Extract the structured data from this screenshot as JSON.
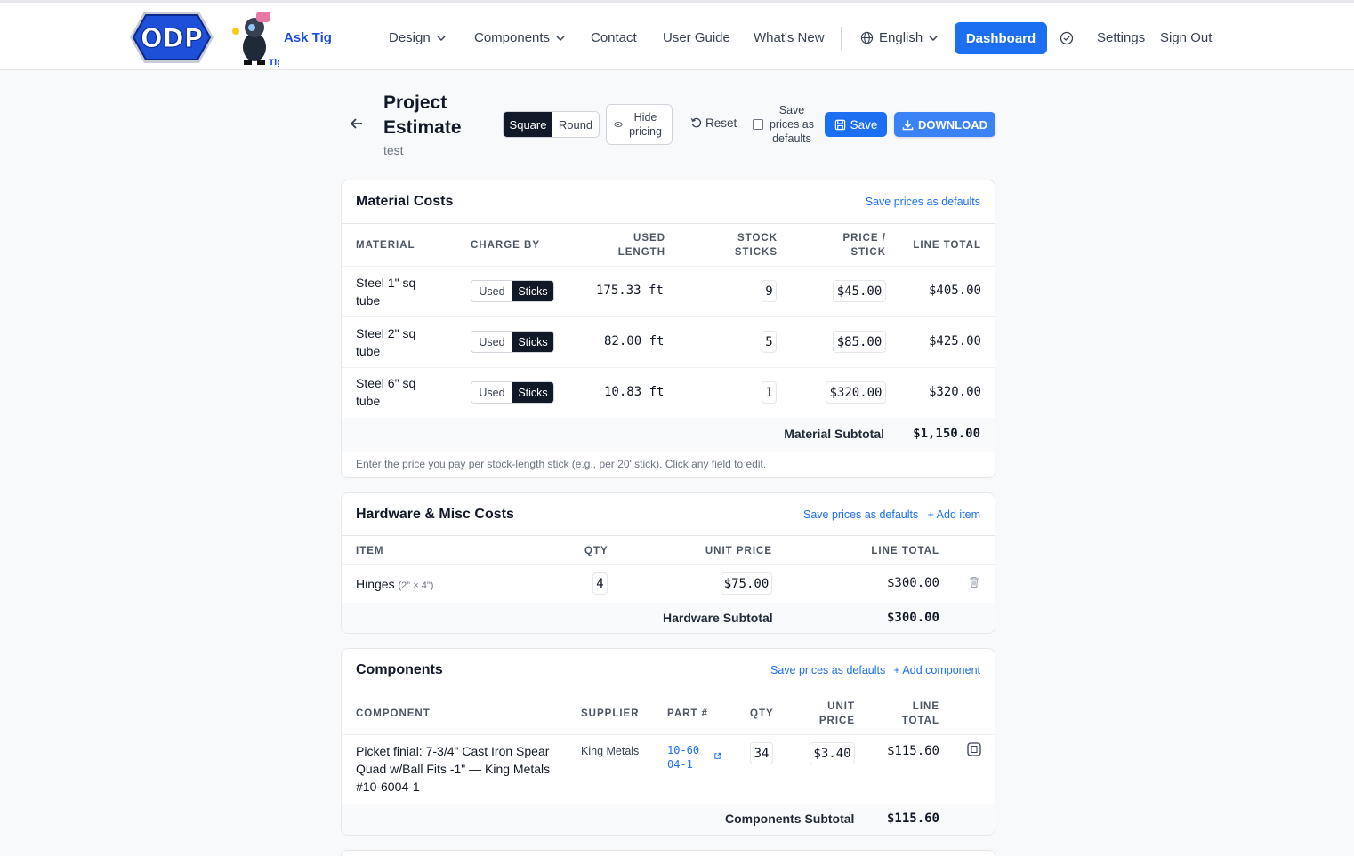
{
  "header": {
    "logo_text": "ODP",
    "ask_tig": "Ask Tig",
    "nav": [
      "Design",
      "Components",
      "Contact",
      "User Guide",
      "What's New"
    ],
    "language": "English",
    "dashboard": "Dashboard",
    "settings": "Settings",
    "sign_out": "Sign Out"
  },
  "page": {
    "title": "Project Estimate",
    "subtitle": "test",
    "shape_options": [
      "Square",
      "Round"
    ],
    "shape_selected": "Square",
    "hide_pricing": "Hide pricing",
    "reset": "Reset",
    "save_defaults_label": "Save prices as defaults",
    "save": "Save",
    "download": "DOWNLOAD"
  },
  "material": {
    "title": "Material Costs",
    "save_defaults": "Save prices as defaults",
    "headers": {
      "material": "MATERIAL",
      "charge_by": "CHARGE BY",
      "used_length": "USED LENGTH",
      "stock_sticks": "STOCK STICKS",
      "price_stick": "PRICE / STICK",
      "line_total": "LINE TOTAL"
    },
    "charge_options": [
      "Used",
      "Sticks"
    ],
    "rows": [
      {
        "name": "Steel 1\" sq tube",
        "charge": "Sticks",
        "used": "175.33 ft",
        "sticks": "9",
        "price": "$45.00",
        "total": "$405.00"
      },
      {
        "name": "Steel 2\" sq tube",
        "charge": "Sticks",
        "used": "82.00 ft",
        "sticks": "5",
        "price": "$85.00",
        "total": "$425.00"
      },
      {
        "name": "Steel 6\" sq tube",
        "charge": "Sticks",
        "used": "10.83 ft",
        "sticks": "1",
        "price": "$320.00",
        "total": "$320.00"
      }
    ],
    "subtotal_label": "Material Subtotal",
    "subtotal": "$1,150.00",
    "footnote": "Enter the price you pay per stock-length stick (e.g., per 20' stick). Click any field to edit."
  },
  "hardware": {
    "title": "Hardware & Misc Costs",
    "save_defaults": "Save prices as defaults",
    "add_item": "+ Add item",
    "headers": {
      "item": "ITEM",
      "qty": "QTY",
      "unit_price": "UNIT PRICE",
      "line_total": "LINE TOTAL"
    },
    "rows": [
      {
        "name": "Hinges",
        "detail": "(2\" × 4\")",
        "qty": "4",
        "price": "$75.00",
        "total": "$300.00"
      }
    ],
    "subtotal_label": "Hardware Subtotal",
    "subtotal": "$300.00"
  },
  "components": {
    "title": "Components",
    "save_defaults": "Save prices as defaults",
    "add_component": "+ Add component",
    "headers": {
      "component": "COMPONENT",
      "supplier": "SUPPLIER",
      "part": "PART #",
      "qty": "QTY",
      "unit_price": "UNIT PRICE",
      "line_total": "LINE TOTAL"
    },
    "rows": [
      {
        "name": "Picket finial: 7-3/4\" Cast Iron Spear Quad w/Ball Fits -1\" — King Metals #10-6004-1",
        "supplier": "King Metals",
        "part": "10-6004-1",
        "qty": "34",
        "price": "$3.40",
        "total": "$115.60"
      }
    ],
    "subtotal_label": "Components Subtotal",
    "subtotal": "$115.60"
  },
  "colors": {
    "primary": "#1d6ff2",
    "dark": "#111827",
    "logo_blue": "#1e4fd8"
  }
}
